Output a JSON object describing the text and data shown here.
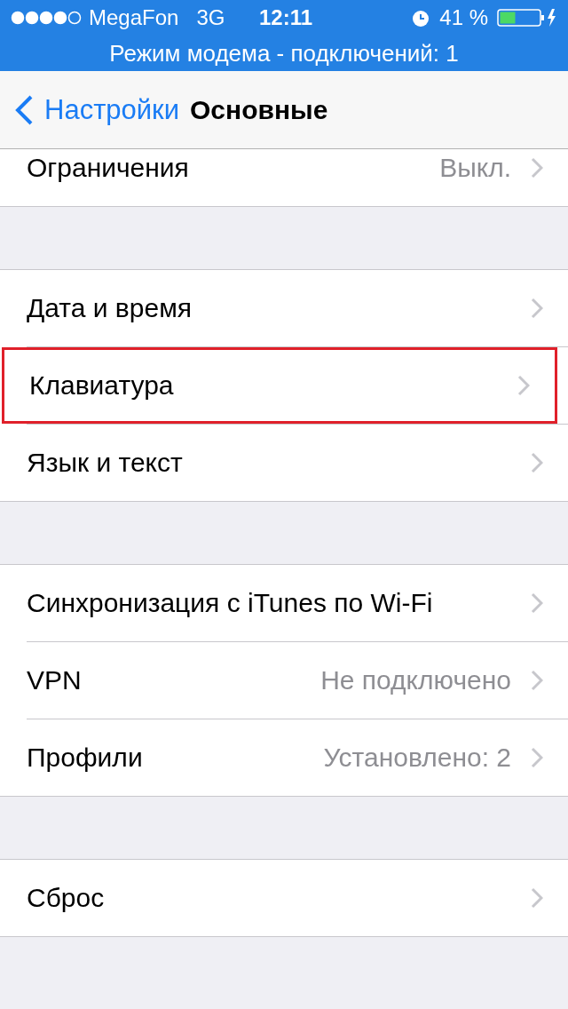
{
  "status_bar": {
    "carrier": "MegaFon",
    "network": "3G",
    "time": "12:11",
    "battery_percent": "41 %"
  },
  "hotspot_banner": "Режим модема - подключений: 1",
  "nav_bar": {
    "back_label": "Настройки",
    "title": "Основные"
  },
  "groups": [
    {
      "partial": true,
      "rows": [
        {
          "label": "Ограничения",
          "value": "Выкл.",
          "highlighted": false
        }
      ]
    },
    {
      "partial": false,
      "rows": [
        {
          "label": "Дата и время",
          "highlighted": false
        },
        {
          "label": "Клавиатура",
          "highlighted": true
        },
        {
          "label": "Язык и текст",
          "highlighted": false
        }
      ]
    },
    {
      "partial": false,
      "rows": [
        {
          "label": "Синхронизация с iTunes по Wi-Fi",
          "highlighted": false
        },
        {
          "label": "VPN",
          "value": "Не подключено",
          "highlighted": false
        },
        {
          "label": "Профили",
          "value": "Установлено: 2",
          "highlighted": false
        }
      ]
    },
    {
      "partial": false,
      "rows": [
        {
          "label": "Сброс",
          "highlighted": false
        }
      ]
    }
  ]
}
